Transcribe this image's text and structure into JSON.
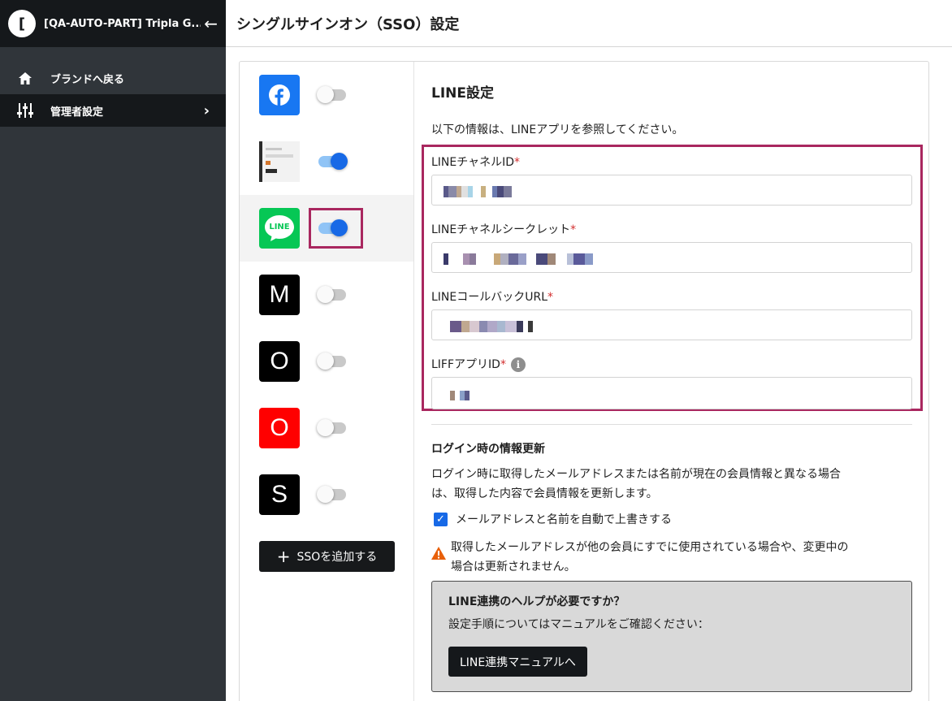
{
  "sidebar": {
    "logo_char": "[",
    "brand_name": "[QA-AUTO-PART] Tripla G...",
    "back_arrow": "←",
    "items": [
      {
        "label": "ブランドへ戻る",
        "icon": "home-icon"
      },
      {
        "label": "管理者設定",
        "icon": "sliders-icon",
        "chevron": "›"
      }
    ]
  },
  "header": {
    "title": "シングルサインオン（SSO）設定"
  },
  "providers": [
    {
      "name": "facebook",
      "icon": "facebook-icon",
      "color": "#1877f2",
      "enabled": false
    },
    {
      "name": "custom-image",
      "icon": "image-thumbnail-icon",
      "enabled": true
    },
    {
      "name": "line",
      "icon": "line-icon",
      "color": "#06c755",
      "icon_text": "LINE",
      "enabled": true,
      "selected": true
    },
    {
      "name": "m",
      "icon_text": "M",
      "color": "#000000",
      "enabled": false
    },
    {
      "name": "o",
      "icon_text": "O",
      "color": "#000000",
      "enabled": false
    },
    {
      "name": "o-red",
      "icon_text": "O",
      "color": "#ff0000",
      "enabled": false
    },
    {
      "name": "s",
      "icon_text": "S",
      "color": "#000000",
      "enabled": false
    }
  ],
  "add_sso": {
    "plus": "+",
    "label": "SSOを追加する"
  },
  "line_settings": {
    "title": "LINE設定",
    "intro": "以下の情報は、LINEアプリを参照してください。",
    "required_mark": "*",
    "fields": [
      {
        "label": "LINEチャネルID"
      },
      {
        "label": "LINEチャネルシークレット"
      },
      {
        "label": "LINEコールバックURL"
      },
      {
        "label": "LIFFアプリID",
        "info": "i"
      }
    ]
  },
  "login_update": {
    "title": "ログイン時の情報更新",
    "desc_line1": "ログイン時に取得したメールアドレスまたは名前が現在の会員情報と異なる場合",
    "desc_line2": "は、取得した内容で会員情報を更新します。",
    "checkbox_label": "メールアドレスと名前を自動で上書きする",
    "checkbox_checked": true,
    "warning_line1": "取得したメールアドレスが他の会員にすでに使用されている場合や、変更中の",
    "warning_line2": "場合は更新されません。"
  },
  "help": {
    "title": "LINE連携のヘルプが必要ですか？",
    "text": "設定手順についてはマニュアルをご確認ください：",
    "button": "LINE連携マニュアルへ"
  },
  "colors": {
    "sidebar_bg": "#30353a",
    "sidebar_dark": "#15181b",
    "accent": "#1769e6",
    "highlight": "#a9275f",
    "required": "#d32f2f",
    "line_green": "#06c755",
    "facebook_blue": "#1877f2"
  }
}
